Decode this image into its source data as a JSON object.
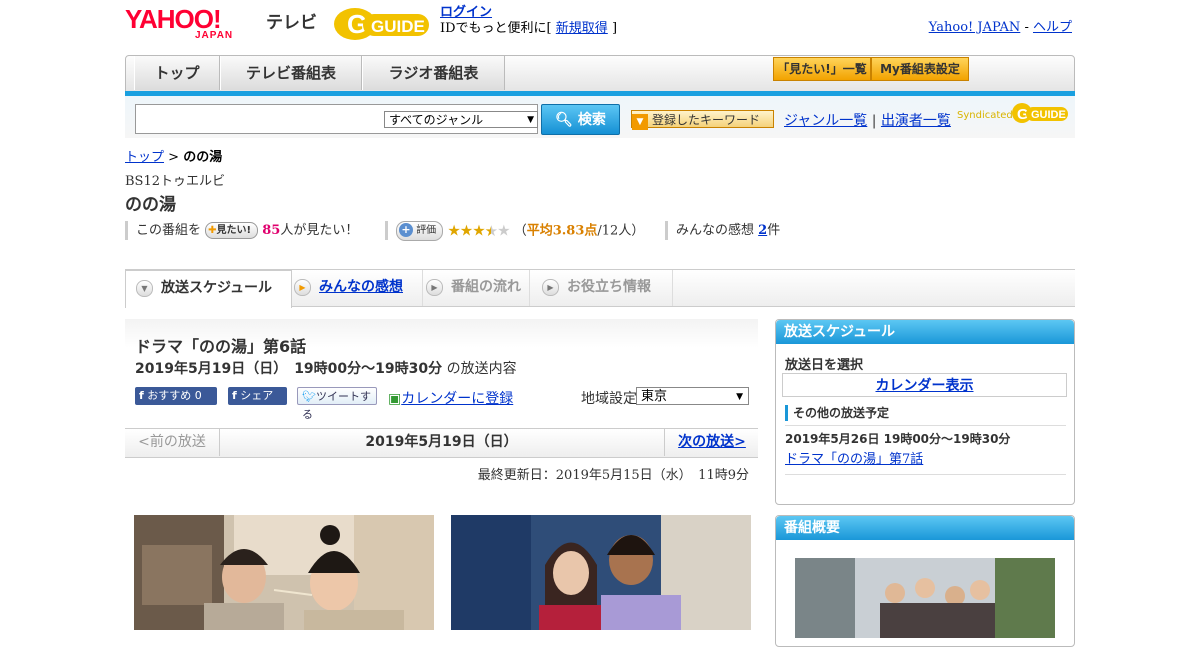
{
  "header": {
    "yahoo_logo": "YAHOO!",
    "japan_logo": "JAPAN",
    "tv_label": "テレビ",
    "gguide_logo": "GUIDE",
    "login_label": "ログイン",
    "login_text_pre": "IDでもっと便利に[",
    "signup_label": "新規取得",
    "login_text_post": "]",
    "yahoo_japan_link": "Yahoo! JAPAN",
    "separator": "-",
    "help_link": "ヘルプ"
  },
  "nav": {
    "tabs": [
      "トップ",
      "テレビ番組表",
      "ラジオ番組表"
    ],
    "mitai_list": "「見たい!」一覧",
    "my_schedule": "My番組表設定"
  },
  "search": {
    "genre_value": "すべてのジャンル",
    "search_button": "検索",
    "keyword_button": "登録したキーワード",
    "genre_list": "ジャンル一覧",
    "divider": "|",
    "performer_list": "出演者一覧",
    "syndicated": "Syndicated"
  },
  "breadcrumb": {
    "top": "トップ",
    "sep": ">",
    "current": "のの湯"
  },
  "program": {
    "channel": "BS12トゥエルビ",
    "title": "のの湯",
    "mitai_pre": "この番組を",
    "mitai_button": "見たい!",
    "mitai_count": "85",
    "mitai_post": "人が見たい！",
    "rating_button": "評価",
    "rating_value": 3.83,
    "rating_text_pre": "（",
    "rating_avg": "平均3.83点",
    "rating_text_post": "/12人）",
    "impressions_pre": "みんなの感想",
    "impressions_count": "2",
    "impressions_post": "件"
  },
  "tabs": [
    "放送スケジュール",
    "みんなの感想",
    "番組の流れ",
    "お役立ち情報"
  ],
  "episode": {
    "title": "ドラマ「のの湯」第6話",
    "date": "2019年5月19日（日）　19時00分～19時30分",
    "date_suffix": "の放送内容",
    "fb_recommend": "おすすめ 0",
    "fb_share": "シェア",
    "tweet": "ツイートする",
    "calendar_register": "カレンダーに登録",
    "region_label": "地域設定",
    "region_value": "東京"
  },
  "datenav": {
    "prev": "<前の放送",
    "current": "2019年5月19日（日）",
    "next": "次の放送>"
  },
  "updated": "最終更新日：2019年5月15日（水）　11時9分",
  "sidebar": {
    "schedule_head": "放送スケジュール",
    "select_date": "放送日を選択",
    "calendar_button": "カレンダー表示",
    "other_head": "その他の放送予定",
    "other_date": "2019年5月26日  19時00分～19時30分",
    "other_title": "ドラマ「のの湯」第7話",
    "overview_head": "番組概要"
  },
  "colors": {
    "accent_blue": "#1a97d8",
    "yahoo_red": "#ff0033",
    "gguide_yellow": "#f2c200",
    "star": "#e0a600"
  }
}
